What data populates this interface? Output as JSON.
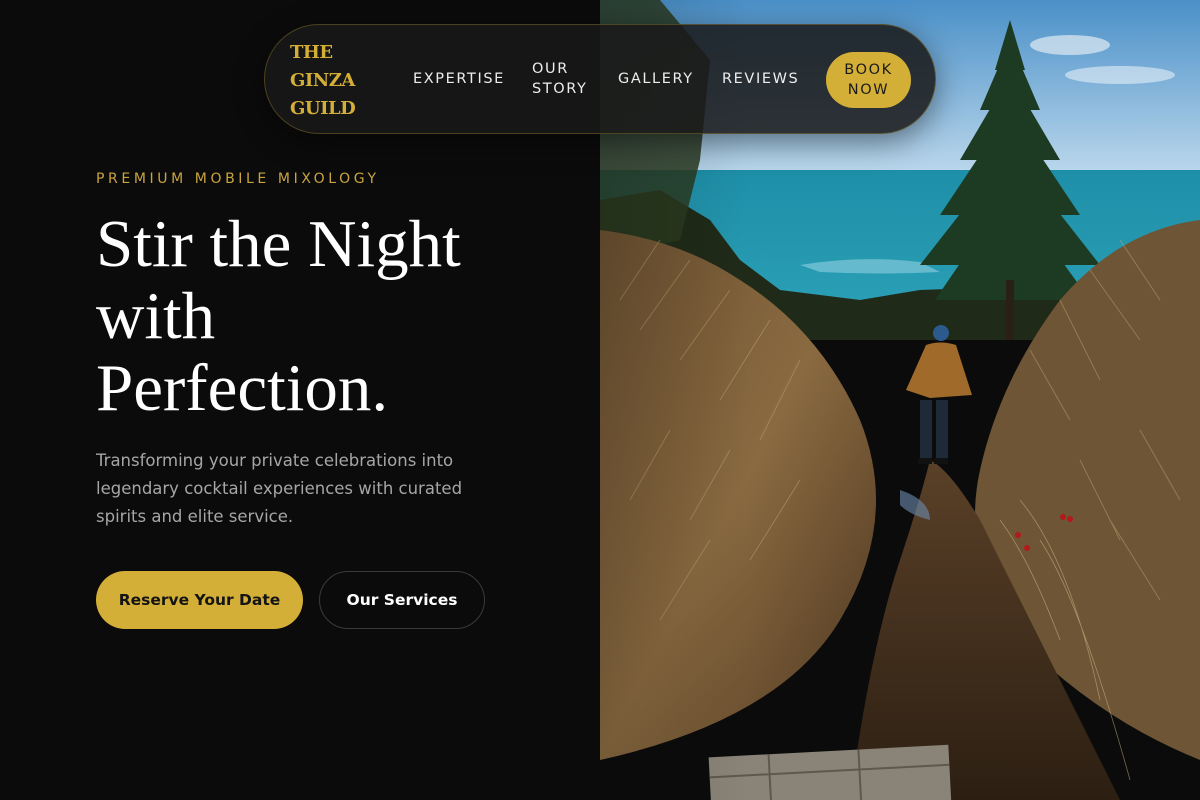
{
  "brand": {
    "lines": [
      "THE",
      "GINZA",
      "GUILD"
    ]
  },
  "nav": {
    "expertise": "EXPERTISE",
    "our_story": [
      "OUR",
      "STORY"
    ],
    "gallery": "GALLERY",
    "reviews": "REVIEWS",
    "book_now": [
      "BOOK",
      "NOW"
    ]
  },
  "hero": {
    "eyebrow": "PREMIUM MOBILE MIXOLOGY",
    "headline": [
      "Stir the Night",
      "with",
      "Perfection."
    ],
    "subcopy": [
      "Transforming your private celebrations into",
      "legendary cocktail experiences with curated",
      "spirits and elite service."
    ],
    "primary_cta": "Reserve Your Date",
    "secondary_cta": "Our Services"
  },
  "colors": {
    "accent": "#d4af37",
    "background": "#0b0b0b",
    "text_primary": "#ffffff",
    "text_muted": "#a6a6a6"
  }
}
